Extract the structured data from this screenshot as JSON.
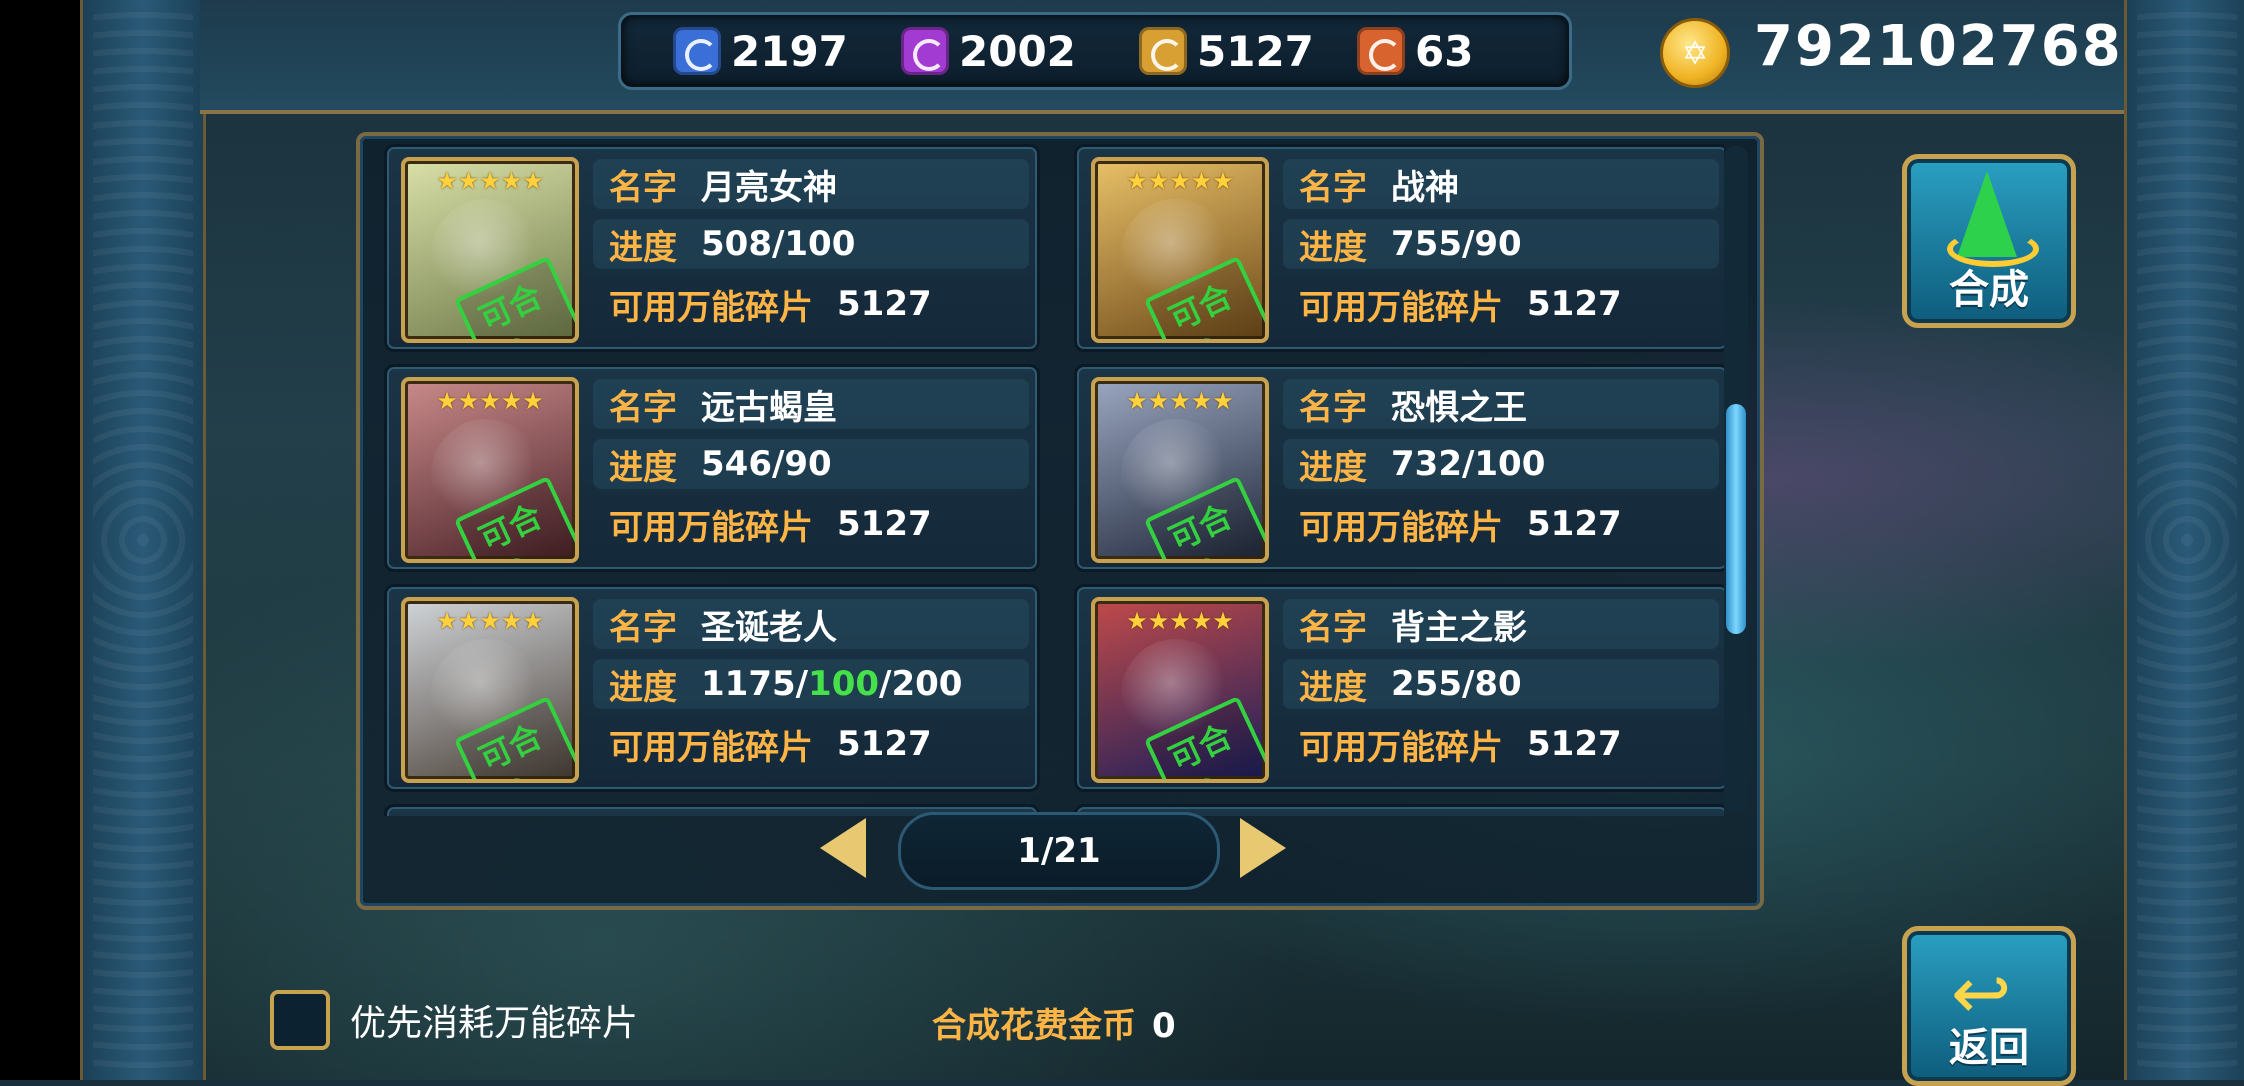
{
  "resources": {
    "blue": {
      "value": "2197",
      "color": "#3a6fd8",
      "icon": "blue-puzzle-icon"
    },
    "purple": {
      "value": "2002",
      "color": "#a23bd2",
      "icon": "purple-puzzle-icon"
    },
    "gold": {
      "value": "5127",
      "color": "#d8a032",
      "icon": "gold-puzzle-icon"
    },
    "orange": {
      "value": "63",
      "color": "#d8632e",
      "icon": "orange-puzzle-icon"
    }
  },
  "gold_coins": "792102768",
  "labels": {
    "name": "名字",
    "progress": "进度",
    "available": "可用万能碎片",
    "stamp": "可合成",
    "stars": "★★★★★"
  },
  "cards": [
    {
      "name": "月亮女神",
      "progress": "508/100",
      "available": "5127",
      "portrait_color": "#b9c48a"
    },
    {
      "name": "战神",
      "progress": "755/90",
      "available": "5127",
      "portrait_color": "#c99a3a"
    },
    {
      "name": "远古蝎皇",
      "progress": "546/90",
      "available": "5127",
      "portrait_color": "#8a4a55"
    },
    {
      "name": "恐惧之王",
      "progress": "732/100",
      "available": "5127",
      "portrait_color": "#4b5a78"
    },
    {
      "name": "圣诞老人",
      "progress_parts": [
        "1175/",
        "100",
        "/200"
      ],
      "available": "5127",
      "portrait_color": "#9aa0a8"
    },
    {
      "name": "背主之影",
      "progress": "255/80",
      "available": "5127",
      "portrait_color": "#3a3c8a"
    }
  ],
  "pager": {
    "text": "1/21"
  },
  "buttons": {
    "synthesize": "合成",
    "back": "返回"
  },
  "bottom": {
    "prefer_label": "优先消耗万能碎片",
    "cost_label": "合成花费金币",
    "cost_value": "0"
  }
}
